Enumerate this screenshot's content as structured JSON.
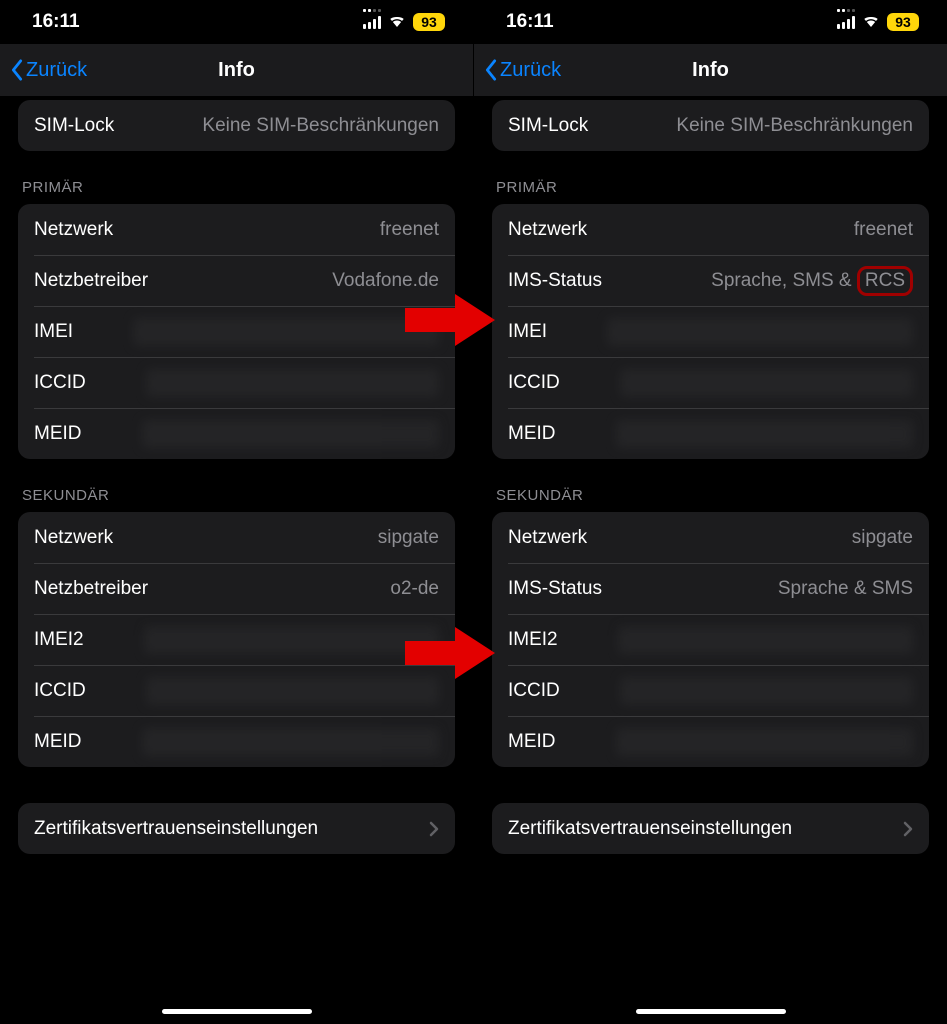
{
  "status": {
    "time": "16:11",
    "battery": "93"
  },
  "nav": {
    "back": "Zurück",
    "title": "Info"
  },
  "simlock": {
    "label": "SIM-Lock",
    "value": "Keine SIM-Beschränkungen"
  },
  "left": {
    "primary": {
      "header": "PRIMÄR",
      "rows": [
        {
          "label": "Netzwerk",
          "value": "freenet"
        },
        {
          "label": "Netzbetreiber",
          "value": "Vodafone.de"
        },
        {
          "label": "IMEI",
          "value": ""
        },
        {
          "label": "ICCID",
          "value": ""
        },
        {
          "label": "MEID",
          "value": ""
        }
      ]
    },
    "secondary": {
      "header": "SEKUNDÄR",
      "rows": [
        {
          "label": "Netzwerk",
          "value": "sipgate"
        },
        {
          "label": "Netzbetreiber",
          "value": "o2-de"
        },
        {
          "label": "IMEI2",
          "value": ""
        },
        {
          "label": "ICCID",
          "value": ""
        },
        {
          "label": "MEID",
          "value": ""
        }
      ]
    }
  },
  "right": {
    "primary": {
      "header": "PRIMÄR",
      "rows": [
        {
          "label": "Netzwerk",
          "value": "freenet"
        },
        {
          "label": "IMS-Status",
          "value_prefix": "Sprache, SMS & ",
          "value_highlight": "RCS"
        },
        {
          "label": "IMEI",
          "value": ""
        },
        {
          "label": "ICCID",
          "value": ""
        },
        {
          "label": "MEID",
          "value": ""
        }
      ]
    },
    "secondary": {
      "header": "SEKUNDÄR",
      "rows": [
        {
          "label": "Netzwerk",
          "value": "sipgate"
        },
        {
          "label": "IMS-Status",
          "value": "Sprache & SMS"
        },
        {
          "label": "IMEI2",
          "value": ""
        },
        {
          "label": "ICCID",
          "value": ""
        },
        {
          "label": "MEID",
          "value": ""
        }
      ]
    }
  },
  "cert": {
    "label": "Zertifikatsvertrauenseinstellungen"
  }
}
